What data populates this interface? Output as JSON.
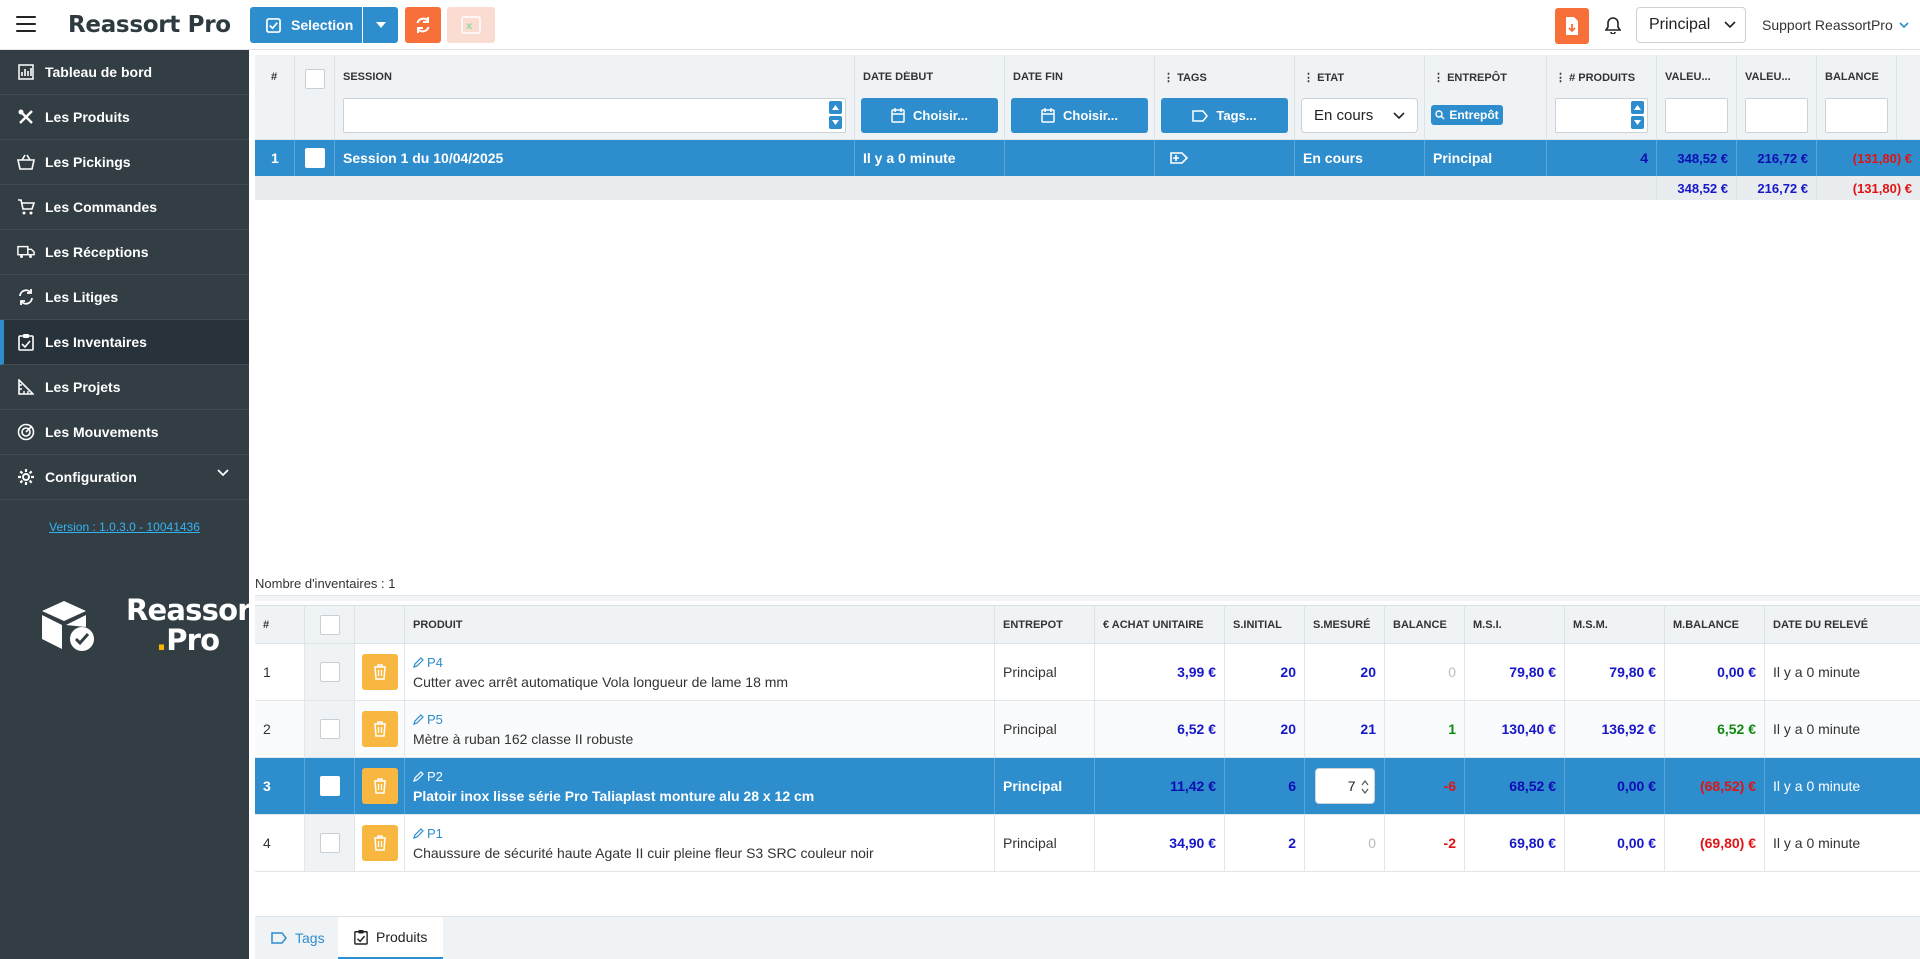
{
  "app": {
    "title": "Reassort Pro"
  },
  "topbar": {
    "selection_label": "Selection",
    "warehouse": "Principal",
    "user": "Support ReassortPro"
  },
  "sidebar": {
    "items": [
      {
        "label": "Tableau de bord",
        "icon": "chart-icon"
      },
      {
        "label": "Les Produits",
        "icon": "tools-icon"
      },
      {
        "label": "Les Pickings",
        "icon": "basket-icon"
      },
      {
        "label": "Les Commandes",
        "icon": "cart-icon"
      },
      {
        "label": "Les Réceptions",
        "icon": "truck-icon"
      },
      {
        "label": "Les Litiges",
        "icon": "exchange-icon"
      },
      {
        "label": "Les Inventaires",
        "icon": "clipboard-icon"
      },
      {
        "label": "Les Projets",
        "icon": "ruler-icon"
      },
      {
        "label": "Les Mouvements",
        "icon": "radar-icon"
      },
      {
        "label": "Configuration",
        "icon": "gear-icon"
      }
    ],
    "version": "Version : 1.0.3.0 - 10041436",
    "logo_line1": "Reassort",
    "logo_line2_dot": ".",
    "logo_line2": "Pro"
  },
  "sessions": {
    "columns": {
      "num": "#",
      "session": "SESSION",
      "date_debut": "DATE DÉBUT",
      "date_fin": "DATE FIN",
      "tags": "TAGS",
      "etat": "ETAT",
      "entrepot": "ENTREPÔT",
      "nb_produits": "# PRODUITS",
      "valeur1": "VALEU...",
      "valeur2": "VALEU...",
      "balance": "BALANCE"
    },
    "filters": {
      "choose_start": "Choisir...",
      "choose_end": "Choisir...",
      "tags": "Tags...",
      "etat": "En cours",
      "entrepot": "Entrepôt"
    },
    "row": {
      "num": "1",
      "session": "Session 1 du 10/04/2025",
      "date_debut": "Il y a 0 minute",
      "etat": "En cours",
      "entrepot": "Principal",
      "nb_produits": "4",
      "valeur1": "348,52 €",
      "valeur2": "216,72 €",
      "balance": "(131,80) €"
    },
    "totals": {
      "valeur1": "348,52 €",
      "valeur2": "216,72 €",
      "balance": "(131,80) €"
    },
    "count_label": "Nombre d'inventaires : 1"
  },
  "products": {
    "columns": {
      "num": "#",
      "produit": "PRODUIT",
      "entrepot": "ENTREPOT",
      "achat": "€ ACHAT UNITAIRE",
      "s_initial": "S.INITIAL",
      "s_mesure": "S.MESURÉ",
      "balance": "BALANCE",
      "msi": "M.S.I.",
      "msm": "M.S.M.",
      "mbalance": "M.BALANCE",
      "date": "DATE DU RELEVÉ"
    },
    "rows": [
      {
        "num": "1",
        "ref": "P4",
        "name": "Cutter avec arrêt automatique Vola longueur de lame 18 mm",
        "entrepot": "Principal",
        "achat": "3,99 €",
        "s_initial": "20",
        "s_mesure": "20",
        "balance": "0",
        "msi": "79,80 €",
        "msm": "79,80 €",
        "mbalance": "0,00 €",
        "date": "Il y a 0 minute"
      },
      {
        "num": "2",
        "ref": "P5",
        "name": "Mètre à ruban 162 classe II robuste",
        "entrepot": "Principal",
        "achat": "6,52 €",
        "s_initial": "20",
        "s_mesure": "21",
        "balance": "1",
        "msi": "130,40 €",
        "msm": "136,92 €",
        "mbalance": "6,52 €",
        "date": "Il y a 0 minute"
      },
      {
        "num": "3",
        "ref": "P2",
        "name": "Platoir inox lisse série Pro Taliaplast monture alu 28 x 12 cm",
        "entrepot": "Principal",
        "achat": "11,42 €",
        "s_initial": "6",
        "s_mesure": "7",
        "balance": "-6",
        "msi": "68,52 €",
        "msm": "0,00 €",
        "mbalance": "(68,52) €",
        "date": "Il y a 0 minute"
      },
      {
        "num": "4",
        "ref": "P1",
        "name": "Chaussure de sécurité haute Agate II cuir pleine fleur S3 SRC couleur noir",
        "entrepot": "Principal",
        "achat": "34,90 €",
        "s_initial": "2",
        "s_mesure": "0",
        "balance": "-2",
        "msi": "69,80 €",
        "msm": "0,00 €",
        "mbalance": "(69,80) €",
        "date": "Il y a 0 minute"
      }
    ]
  },
  "tabs": [
    {
      "label": "Tags"
    },
    {
      "label": "Produits"
    }
  ],
  "colors": {
    "primary": "#2e8dcc",
    "accent": "#f7703a",
    "sidebar": "#323e44",
    "delete": "#f7b741",
    "value_blue": "#1717c9",
    "negative_red": "#e01414",
    "positive_green": "#0f8a0f"
  }
}
